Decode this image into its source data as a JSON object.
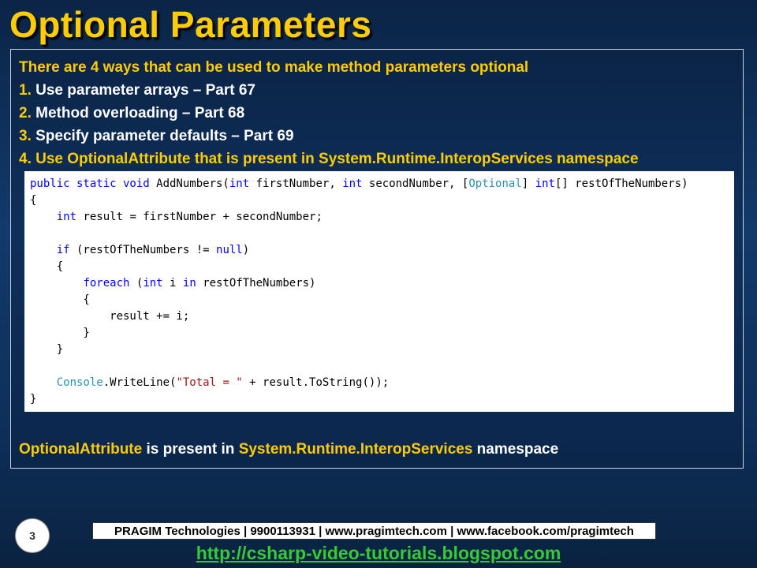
{
  "slide": {
    "title": "Optional Parameters",
    "intro": "There are 4 ways that can be used to make method parameters optional",
    "points": [
      {
        "num": "1.",
        "text": " Use parameter arrays – Part 67"
      },
      {
        "num": "2.",
        "text": " Method overloading – Part 68"
      },
      {
        "num": "3.",
        "text": " Specify parameter defaults – Part 69"
      },
      {
        "num": "4.",
        "text": " Use OptionalAttribute that is present in System.Runtime.InteropServices namespace"
      }
    ],
    "code": {
      "l1_a": "public static void",
      "l1_b": " AddNumbers(",
      "l1_c": "int",
      "l1_d": " firstNumber, ",
      "l1_e": "int",
      "l1_f": " secondNumber, [",
      "l1_g": "Optional",
      "l1_h": "] ",
      "l1_i": "int",
      "l1_j": "[] restOfTheNumbers)",
      "l2": "{",
      "l3_indent": "    ",
      "l3_a": "int",
      "l3_b": " result = firstNumber + secondNumber;",
      "l5_indent": "    ",
      "l5_a": "if",
      "l5_b": " (restOfTheNumbers != ",
      "l5_c": "null",
      "l5_d": ")",
      "l6": "    {",
      "l7_indent": "        ",
      "l7_a": "foreach",
      "l7_b": " (",
      "l7_c": "int",
      "l7_d": " i ",
      "l7_e": "in",
      "l7_f": " restOfTheNumbers)",
      "l8": "        {",
      "l9": "            result += i;",
      "l10": "        }",
      "l11": "    }",
      "l13_indent": "    ",
      "l13_a": "Console",
      "l13_b": ".WriteLine(",
      "l13_c": "\"Total = \"",
      "l13_d": " + result.ToString());",
      "l14": "}"
    },
    "note": {
      "a": "OptionalAttribute",
      "b": " is present in ",
      "c": "System.Runtime.InteropServices",
      "d": " namespace"
    }
  },
  "footer": {
    "page_number": "3",
    "company": "PRAGIM Technologies | 9900113931 | www.pragimtech.com | www.facebook.com/pragimtech",
    "blog_url": "http://csharp-video-tutorials.blogspot.com"
  },
  "colors": {
    "title": "#ffcc00",
    "keyword": "#0000ff",
    "type": "#2b91af",
    "string": "#a31515",
    "link": "#33cc33"
  }
}
